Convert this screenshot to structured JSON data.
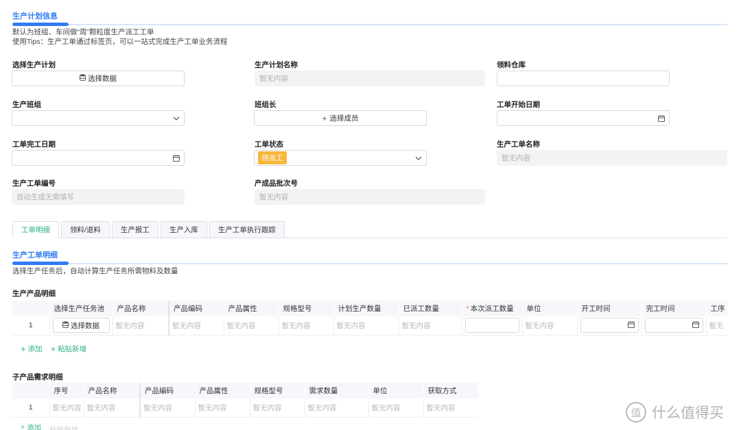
{
  "section1": {
    "title": "生产计划信息",
    "desc_line1": "默认为班组、车间做“周”颗粒度生产派工工单",
    "desc_line2": "使用Tips：生产工单通过标签页，可以一站式完成生产工单业务流程"
  },
  "form": {
    "plan_label": "选择生产计划",
    "plan_button": "选择数据",
    "plan_name_label": "生产计划名称",
    "plan_name_placeholder": "暂无内容",
    "warehouse_label": "领料仓库",
    "team_label": "生产班组",
    "leader_label": "班组长",
    "leader_button": "选择成员",
    "start_date_label": "工单开始日期",
    "end_date_label": "工单完工日期",
    "status_label": "工单状态",
    "status_value": "待派工",
    "order_name_label": "生产工单名称",
    "order_name_placeholder": "暂无内容",
    "order_no_label": "生产工单编号",
    "order_no_placeholder": "自动生成无需填写",
    "batch_label": "产成品批次号",
    "batch_placeholder": "暂无内容"
  },
  "tabs": [
    "工单明细",
    "领料/退料",
    "生产报工",
    "生产入库",
    "生产工单执行跟踪"
  ],
  "section2": {
    "title": "生产工单明细",
    "desc": "选择生产任务后，自动计算生产任务所需物料及数量"
  },
  "product_table": {
    "title": "生产产品明细",
    "headers": [
      "选择生产任务池",
      "产品名称",
      "产品编码",
      "产品属性",
      "规格型号",
      "计划生产数量",
      "已派工数量",
      "本次派工数量",
      "单位",
      "开工时间",
      "完工时间",
      "工序"
    ],
    "row_index": "1",
    "select_button": "选择数据",
    "placeholder": "暂无内容",
    "placeholder_cut": "暂无"
  },
  "actions": {
    "add": "添加",
    "paste": "粘贴新增"
  },
  "sub_table": {
    "title": "子产品需求明细",
    "headers": [
      "序号",
      "产品名称",
      "产品编码",
      "产品属性",
      "规格型号",
      "需求数量",
      "单位",
      "获取方式"
    ],
    "row_index": "1",
    "placeholder": "暂无内容"
  },
  "watermark": {
    "glyph": "值",
    "text": "什么值得买"
  },
  "colors": {
    "accent": "#2f7cf6",
    "green": "#2ab07f",
    "status_yellow": "#f7b73a"
  }
}
